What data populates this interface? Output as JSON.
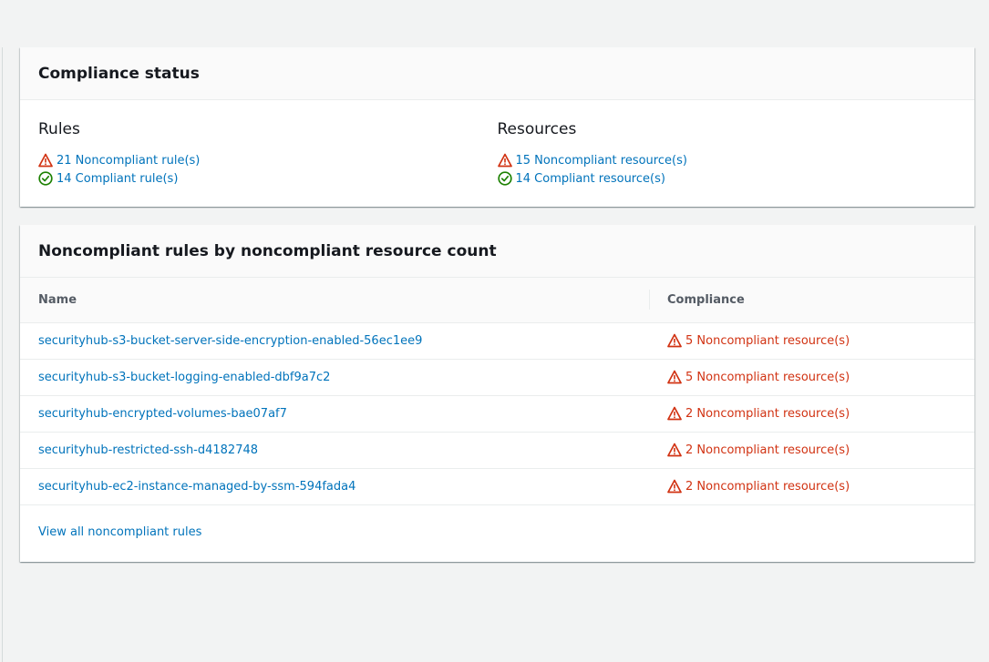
{
  "compliance_status": {
    "title": "Compliance status",
    "rules": {
      "heading": "Rules",
      "noncompliant": "21 Noncompliant rule(s)",
      "compliant": "14 Compliant rule(s)"
    },
    "resources": {
      "heading": "Resources",
      "noncompliant": "15 Noncompliant resource(s)",
      "compliant": "14 Compliant resource(s)"
    }
  },
  "noncompliant_rules": {
    "title": "Noncompliant rules by noncompliant resource count",
    "columns": {
      "name": "Name",
      "compliance": "Compliance"
    },
    "rows": [
      {
        "name": "securityhub-s3-bucket-server-side-encryption-enabled-56ec1ee9",
        "compliance": "5 Noncompliant resource(s)"
      },
      {
        "name": "securityhub-s3-bucket-logging-enabled-dbf9a7c2",
        "compliance": "5 Noncompliant resource(s)"
      },
      {
        "name": "securityhub-encrypted-volumes-bae07af7",
        "compliance": "2 Noncompliant resource(s)"
      },
      {
        "name": "securityhub-restricted-ssh-d4182748",
        "compliance": "2 Noncompliant resource(s)"
      },
      {
        "name": "securityhub-ec2-instance-managed-by-ssm-594fada4",
        "compliance": "2 Noncompliant resource(s)"
      }
    ],
    "view_all": "View all noncompliant rules"
  },
  "icons": {
    "noncompliant": "warning-triangle-icon",
    "compliant": "check-circle-icon"
  },
  "colors": {
    "link": "#0073bb",
    "error": "#d13212",
    "success": "#1d8102"
  }
}
